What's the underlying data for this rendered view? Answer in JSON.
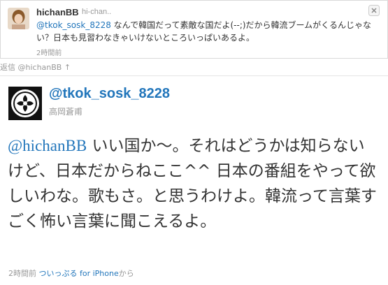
{
  "parent_tweet": {
    "screen_name": "hichanBB",
    "full_name": "hi-chan..",
    "mention": "@tkok_sosk_8228",
    "text_after_mention": " なんで韓国だって素敵な国だよ(--;)だから韓流ブームがくるんじゃない？日本も見習わなきゃいけないところいっぱいあるよ。",
    "timestamp": "2時間前",
    "icons": {
      "avatar": "avatar-photo",
      "close": "close-x-icon"
    }
  },
  "reply_context": {
    "label": "返信 @hichanBB",
    "arrow": "↑"
  },
  "main_tweet": {
    "screen_name": "@tkok_sosk_8228",
    "full_name": "高岡蒼甫",
    "mention": "@hichanBB",
    "text_after_mention": " いい国か〜。それはどうかは知らないけど、日本だからねここ^^ 日本の番組をやって欲しいわな。歌もさ。と思うわけよ。韓流って言葉すごく怖い言葉に聞こえるよ。",
    "timestamp": "2時間前",
    "source": "ついっぷる for iPhone",
    "source_suffix": "から",
    "icons": {
      "avatar": "family-crest-avatar"
    }
  },
  "colors": {
    "link": "#2276bb",
    "text": "#333333",
    "muted": "#999999"
  }
}
